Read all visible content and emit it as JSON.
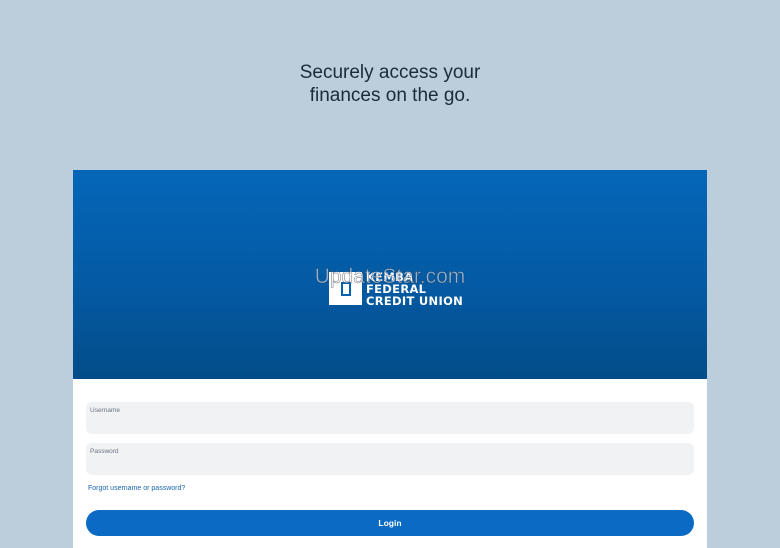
{
  "tagline": {
    "line1": "Securely access your",
    "line2": "finances on the go."
  },
  "brand": {
    "logo_line1": "KEMBA",
    "logo_line2": "FEDERAL",
    "logo_line3": "CREDIT UNION",
    "hero_color": "#0566b9"
  },
  "watermark": "UpdateStar.com",
  "form": {
    "username_label": "Username",
    "username_value": "",
    "password_label": "Password",
    "password_value": "",
    "forgot_link": "Forgot username or password?",
    "login_button": "Login"
  },
  "colors": {
    "background": "#bccddb",
    "accent": "#0b6bc4"
  }
}
